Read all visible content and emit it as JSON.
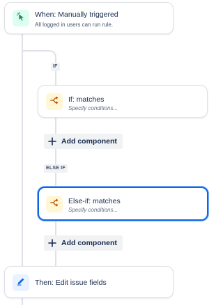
{
  "trigger": {
    "title": "When: Manually triggered",
    "subtitle": "All logged in users can run rule.",
    "icon": "cursor-click-icon",
    "color": "#1f845a"
  },
  "branches": [
    {
      "label": "IF",
      "condition": {
        "title": "If: matches",
        "subtitle": "Specify conditions...",
        "icon": "branch-icon"
      },
      "add_label": "Add component"
    },
    {
      "label": "ELSE IF",
      "condition": {
        "title": "Else-if: matches",
        "subtitle": "Specify conditions...",
        "icon": "branch-icon",
        "selected": true
      },
      "add_label": "Add component"
    }
  ],
  "action": {
    "title": "Then: Edit issue fields",
    "icon": "pencil-icon",
    "color": "#0c66e4"
  },
  "colors": {
    "accent": "#0c66e4",
    "connector": "#dfe1e6",
    "condition_icon": "#c25100"
  }
}
